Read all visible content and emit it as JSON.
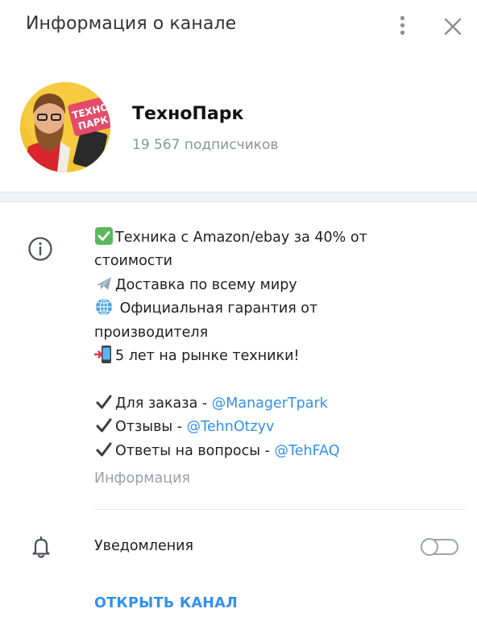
{
  "header": {
    "title": "Информация о канале",
    "more_icon": "more-vertical-icon",
    "close_icon": "close-icon"
  },
  "channel": {
    "name": "ТехноПарк",
    "subscribers": "19 567 подписчиков",
    "avatar_text_line1": "ТЕХНО",
    "avatar_text_line2": "ПАРК"
  },
  "description": {
    "l1": "Техника с Amazon/ebay за 40% от",
    "l2": "стоимости",
    "l3": "Доставка по всему миру",
    "l4": " Официальная гарантия от",
    "l5": "производителя",
    "l6": "5 лет на рынке техники!",
    "order_label": "Для заказа - ",
    "order_link": "@ManagerTpark",
    "reviews_label": "Отзывы - ",
    "reviews_link": "@TehnOtzyv",
    "faq_label": "Ответы на вопросы - ",
    "faq_link": "@TehFAQ",
    "info_label": "Информация"
  },
  "notifications": {
    "label": "Уведомления",
    "enabled": false
  },
  "open_button": "ОТКРЫТЬ КАНАЛ",
  "colors": {
    "accent": "#3390ec",
    "muted": "#8e9398",
    "avatar_bg": "#f4c233"
  }
}
